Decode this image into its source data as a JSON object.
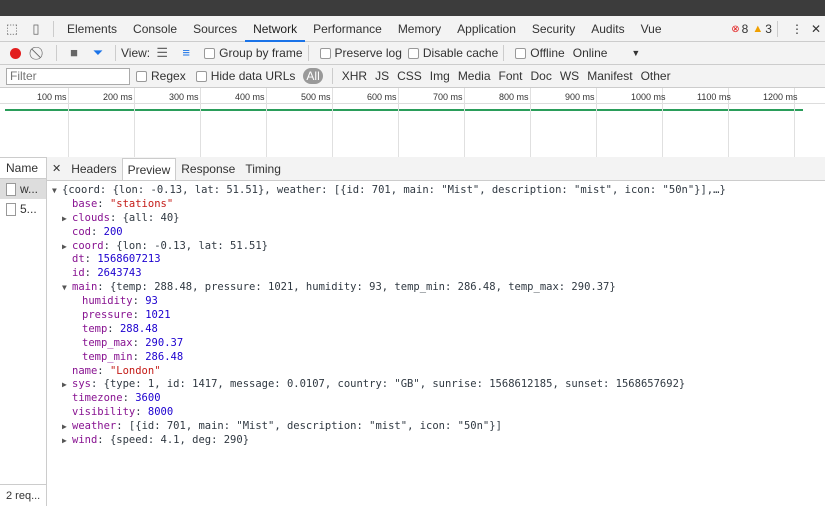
{
  "tabs": [
    "Elements",
    "Console",
    "Sources",
    "Network",
    "Performance",
    "Memory",
    "Application",
    "Security",
    "Audits",
    "Vue"
  ],
  "active_tab": "Network",
  "errors": "8",
  "warnings": "3",
  "toolbar": {
    "view": "View:",
    "group_by_frame": "Group by frame",
    "preserve_log": "Preserve log",
    "disable_cache": "Disable cache",
    "offline": "Offline",
    "throttle": "Online"
  },
  "filterbar": {
    "placeholder": "Filter",
    "regex": "Regex",
    "hide_data_urls": "Hide data URLs",
    "types": [
      "All",
      "XHR",
      "JS",
      "CSS",
      "Img",
      "Media",
      "Font",
      "Doc",
      "WS",
      "Manifest",
      "Other"
    ]
  },
  "timeline_ticks": [
    "100 ms",
    "200 ms",
    "300 ms",
    "400 ms",
    "500 ms",
    "600 ms",
    "700 ms",
    "800 ms",
    "900 ms",
    "1000 ms",
    "1100 ms",
    "1200 ms"
  ],
  "name_header": "Name",
  "requests": [
    "w...",
    "5..."
  ],
  "status": "2 req...",
  "detail_tabs": [
    "Headers",
    "Preview",
    "Response",
    "Timing"
  ],
  "active_detail_tab": "Preview",
  "preview": [
    {
      "indent": 0,
      "toggle": "open",
      "key": "",
      "value": "{coord: {lon: -0.13, lat: 51.51}, weather: [{id: 701, main: \"Mist\", description: \"mist\", icon: \"50n\"}],…}",
      "type": "obj"
    },
    {
      "indent": 1,
      "toggle": "",
      "key": "base",
      "value": "\"stations\"",
      "type": "s"
    },
    {
      "indent": 1,
      "toggle": "closed",
      "key": "clouds",
      "value": "{all: 40}",
      "type": "obj"
    },
    {
      "indent": 1,
      "toggle": "",
      "key": "cod",
      "value": "200",
      "type": "n"
    },
    {
      "indent": 1,
      "toggle": "closed",
      "key": "coord",
      "value": "{lon: -0.13, lat: 51.51}",
      "type": "obj"
    },
    {
      "indent": 1,
      "toggle": "",
      "key": "dt",
      "value": "1568607213",
      "type": "n"
    },
    {
      "indent": 1,
      "toggle": "",
      "key": "id",
      "value": "2643743",
      "type": "n"
    },
    {
      "indent": 1,
      "toggle": "open",
      "key": "main",
      "value": "{temp: 288.48, pressure: 1021, humidity: 93, temp_min: 286.48, temp_max: 290.37}",
      "type": "obj"
    },
    {
      "indent": 2,
      "toggle": "",
      "key": "humidity",
      "value": "93",
      "type": "n"
    },
    {
      "indent": 2,
      "toggle": "",
      "key": "pressure",
      "value": "1021",
      "type": "n"
    },
    {
      "indent": 2,
      "toggle": "",
      "key": "temp",
      "value": "288.48",
      "type": "n"
    },
    {
      "indent": 2,
      "toggle": "",
      "key": "temp_max",
      "value": "290.37",
      "type": "n"
    },
    {
      "indent": 2,
      "toggle": "",
      "key": "temp_min",
      "value": "286.48",
      "type": "n"
    },
    {
      "indent": 1,
      "toggle": "",
      "key": "name",
      "value": "\"London\"",
      "type": "s"
    },
    {
      "indent": 1,
      "toggle": "closed",
      "key": "sys",
      "value": "{type: 1, id: 1417, message: 0.0107, country: \"GB\", sunrise: 1568612185, sunset: 1568657692}",
      "type": "obj"
    },
    {
      "indent": 1,
      "toggle": "",
      "key": "timezone",
      "value": "3600",
      "type": "n"
    },
    {
      "indent": 1,
      "toggle": "",
      "key": "visibility",
      "value": "8000",
      "type": "n"
    },
    {
      "indent": 1,
      "toggle": "closed",
      "key": "weather",
      "value": "[{id: 701, main: \"Mist\", description: \"mist\", icon: \"50n\"}]",
      "type": "obj"
    },
    {
      "indent": 1,
      "toggle": "closed",
      "key": "wind",
      "value": "{speed: 4.1, deg: 290}",
      "type": "obj"
    }
  ],
  "colors": {
    "record": "#e21e1e",
    "filter_icon": "#1a73e8",
    "accent": "#1a73e8",
    "green": "#2a9d5a"
  }
}
